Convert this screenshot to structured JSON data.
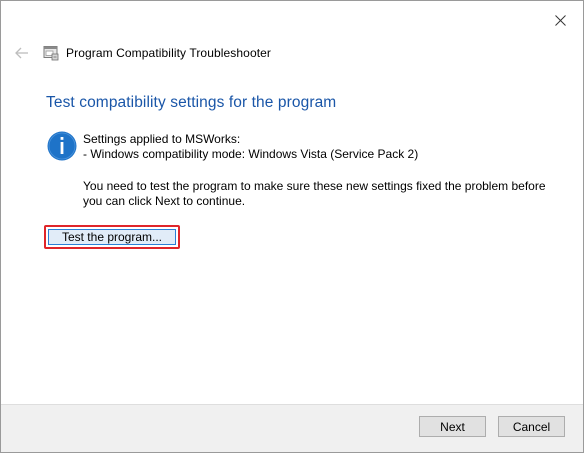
{
  "window": {
    "header_title": "Program Compatibility Troubleshooter"
  },
  "icons": {
    "close": "close-icon",
    "back": "back-arrow-icon",
    "app": "troubleshooter-app-icon",
    "info": "info-icon"
  },
  "content": {
    "heading": "Test compatibility settings for the program",
    "settings_line1": "Settings applied to MSWorks:",
    "settings_line2": "- Windows compatibility mode: Windows Vista (Service Pack 2)",
    "instruction": "You need to test the program to make sure these new settings fixed the problem before you can click Next to continue.",
    "test_button_label": "Test the program..."
  },
  "footer": {
    "next_label": "Next",
    "cancel_label": "Cancel"
  },
  "colors": {
    "heading": "#1a56a8",
    "info_icon": "#1e73c8",
    "highlight": "#e0252a",
    "focus_border": "#2b7fd6"
  }
}
